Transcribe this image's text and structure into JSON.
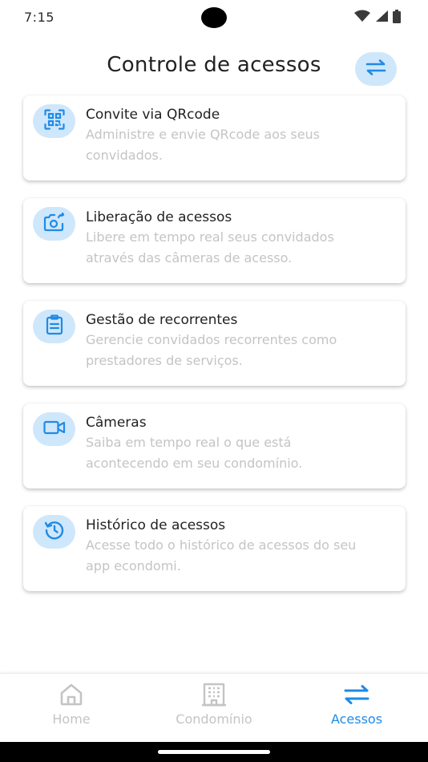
{
  "status_bar": {
    "time": "7:15"
  },
  "header": {
    "title": "Controle de acessos",
    "action_icon": "swap-arrows-icon"
  },
  "colors": {
    "accent": "#1f8be6",
    "icon_bg": "#cfe7fb",
    "muted": "#c4c4c4"
  },
  "cards": [
    {
      "icon": "qrcode-icon",
      "title": "Convite via QRcode",
      "description": "Administre e envie QRcode aos seus convidados."
    },
    {
      "icon": "camera-rotate-icon",
      "title": "Liberação de acessos",
      "description": "Libere em tempo real seus convidados através das câmeras de acesso."
    },
    {
      "icon": "clipboard-icon",
      "title": "Gestão de recorrentes",
      "description": "Gerencie convidados recorrentes como prestadores de serviços."
    },
    {
      "icon": "video-camera-icon",
      "title": "Câmeras",
      "description": "Saiba em tempo real o que está acontecendo em seu condomínio."
    },
    {
      "icon": "history-icon",
      "title": "Histórico de acessos",
      "description": "Acesse todo o histórico de acessos do seu app econdomi."
    }
  ],
  "bottom_nav": {
    "items": [
      {
        "icon": "home-icon",
        "label": "Home"
      },
      {
        "icon": "building-icon",
        "label": "Condomínio"
      },
      {
        "icon": "swap-arrows-icon",
        "label": "Acessos",
        "active": true
      }
    ]
  }
}
